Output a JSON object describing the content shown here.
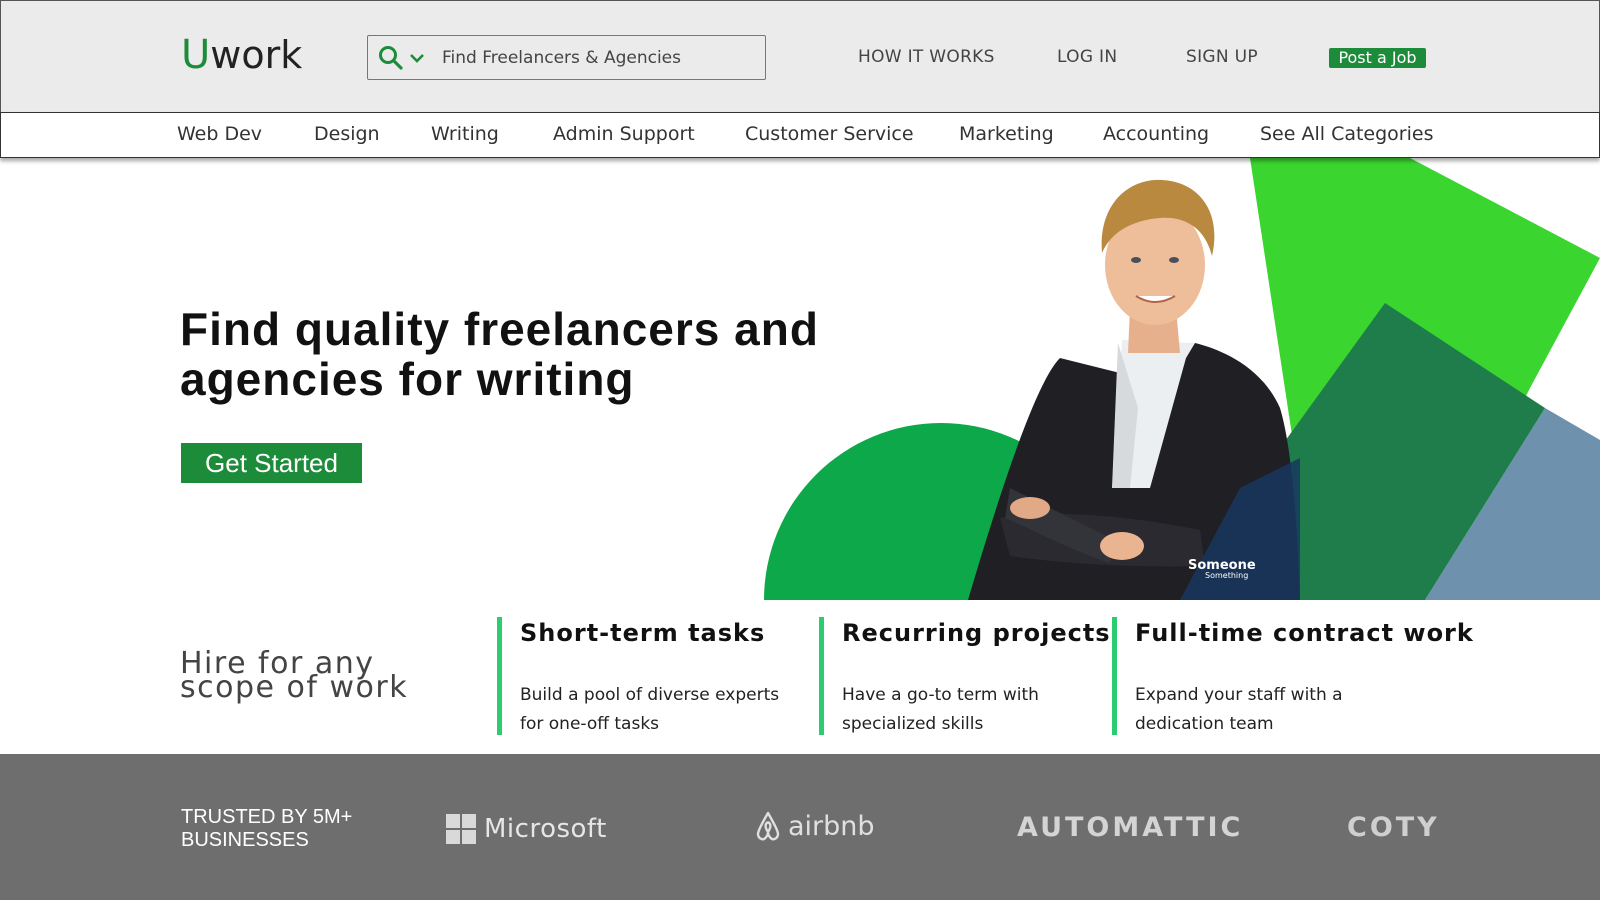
{
  "header": {
    "logo_mark": "U",
    "logo_word": "work",
    "search_placeholder": "Find Freelancers & Agencies",
    "nav": {
      "how_it_works": "HOW IT WORKS",
      "log_in": "LOG IN",
      "sign_up": "SIGN UP",
      "post_job": "Post a Job"
    }
  },
  "categories": [
    "Web Dev",
    "Design",
    "Writing",
    "Admin Support",
    "Customer Service",
    "Marketing",
    "Accounting",
    "See All Categories"
  ],
  "hero": {
    "title": "Find quality freelancers and agencies for writing",
    "cta": "Get Started",
    "photo_caption": "Someone",
    "photo_subcaption": "Something"
  },
  "scope": {
    "title": "Hire for any scope of work",
    "columns": [
      {
        "heading": "Short-term tasks",
        "text": "Build a pool of diverse experts for one-off tasks"
      },
      {
        "heading": "Recurring projects",
        "text": "Have a go-to term with specialized skills"
      },
      {
        "heading": "Full-time contract work",
        "text": "Expand your staff with a dedication team"
      }
    ]
  },
  "trusted": {
    "label": "TRUSTED BY 5M+ BUSINESSES",
    "brands": {
      "microsoft": "Microsoft",
      "airbnb": "airbnb",
      "automattic": "AUTOMATTIC",
      "coty": "COTY"
    }
  },
  "colors": {
    "brand_green": "#1d8c3a",
    "accent_green": "#2ecc71",
    "bright_green": "#3ad52f",
    "dark_green": "#1e7d4a",
    "slate_blue": "#6e92ad",
    "band_gray": "#6e6e6e"
  }
}
